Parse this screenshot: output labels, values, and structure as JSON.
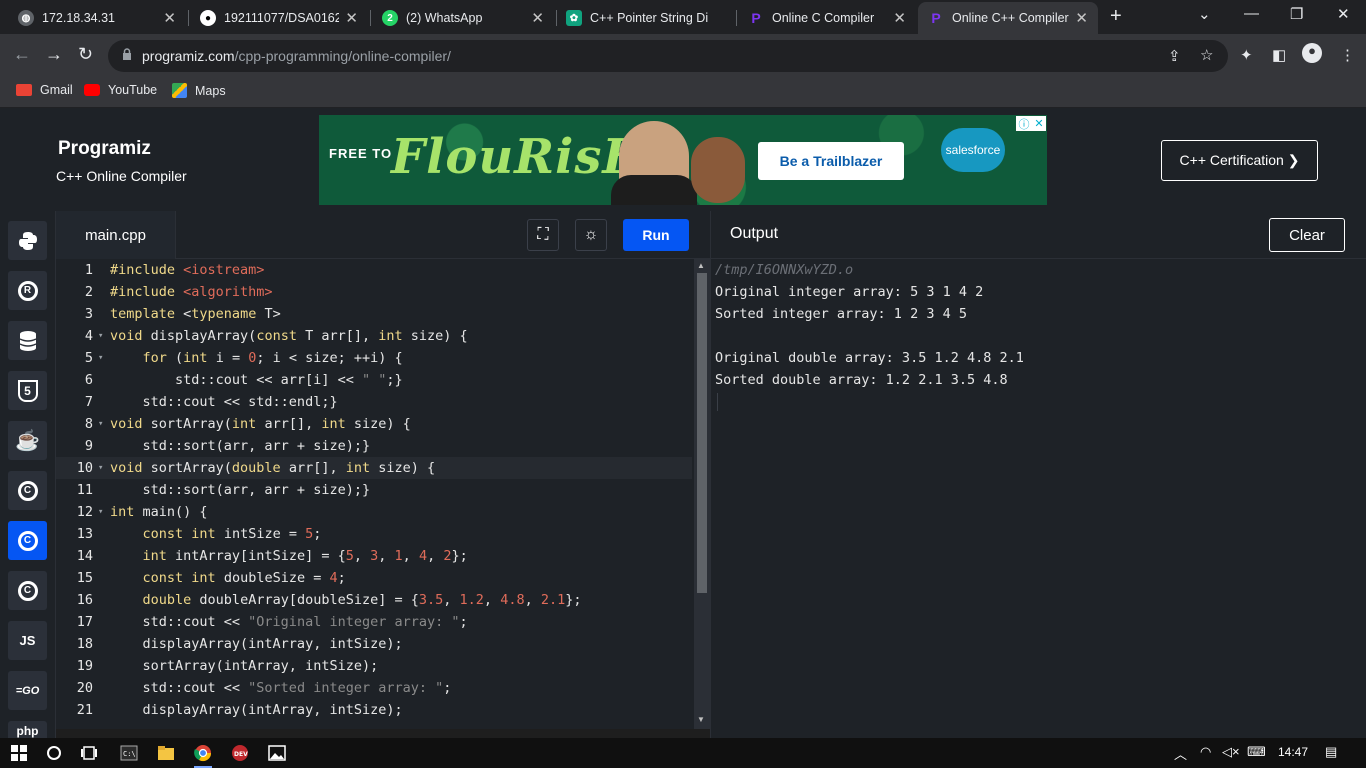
{
  "browser": {
    "tabs": [
      {
        "title": "172.18.34.31",
        "active": false,
        "icon": "globe-icon"
      },
      {
        "title": "192111077/DSA0162",
        "active": false,
        "icon": "github-icon"
      },
      {
        "title": "(2) WhatsApp",
        "active": false,
        "icon": "whatsapp-icon"
      },
      {
        "title": "C++ Pointer String Di",
        "active": false,
        "icon": "chatgpt-icon"
      },
      {
        "title": "Online C Compiler",
        "active": false,
        "icon": "programiz-icon"
      },
      {
        "title": "Online C++ Compiler",
        "active": true,
        "icon": "programiz-icon"
      }
    ],
    "url_domain": "programiz.com",
    "url_path": "/cpp-programming/online-compiler/",
    "bookmarks": [
      {
        "label": "Gmail",
        "icon": "gmail-icon"
      },
      {
        "label": "YouTube",
        "icon": "youtube-icon"
      },
      {
        "label": "Maps",
        "icon": "maps-icon"
      }
    ]
  },
  "site": {
    "logo": "Programiz",
    "subtitle": "C++ Online Compiler",
    "ad": {
      "free_to": "FREE TO",
      "headline": "FlouRisH",
      "cta": "Be a Trailblazer",
      "brand": "salesforce"
    },
    "cert_button": "C++ Certification ❯"
  },
  "editor": {
    "filename": "main.cpp",
    "run_label": "Run",
    "highlighted_line": 10,
    "lines": [
      {
        "n": "1",
        "fold": "",
        "code": "#include <iostream>"
      },
      {
        "n": "2",
        "fold": "",
        "code": "#include <algorithm>"
      },
      {
        "n": "3",
        "fold": "",
        "code": "template <typename T>"
      },
      {
        "n": "4",
        "fold": "▾",
        "code": "void displayArray(const T arr[], int size) {"
      },
      {
        "n": "5",
        "fold": "▾",
        "code": "    for (int i = 0; i < size; ++i) {"
      },
      {
        "n": "6",
        "fold": "",
        "code": "        std::cout << arr[i] << \" \";}"
      },
      {
        "n": "7",
        "fold": "",
        "code": "    std::cout << std::endl;}"
      },
      {
        "n": "8",
        "fold": "▾",
        "code": "void sortArray(int arr[], int size) {"
      },
      {
        "n": "9",
        "fold": "",
        "code": "    std::sort(arr, arr + size);}"
      },
      {
        "n": "10",
        "fold": "▾",
        "code": "void sortArray(double arr[], int size) {"
      },
      {
        "n": "11",
        "fold": "",
        "code": "    std::sort(arr, arr + size);}"
      },
      {
        "n": "12",
        "fold": "▾",
        "code": "int main() {"
      },
      {
        "n": "13",
        "fold": "",
        "code": "    const int intSize = 5;"
      },
      {
        "n": "14",
        "fold": "",
        "code": "    int intArray[intSize] = {5, 3, 1, 4, 2};"
      },
      {
        "n": "15",
        "fold": "",
        "code": "    const int doubleSize = 4;"
      },
      {
        "n": "16",
        "fold": "",
        "code": "    double doubleArray[doubleSize] = {3.5, 1.2, 4.8, 2.1};"
      },
      {
        "n": "17",
        "fold": "",
        "code": "    std::cout << \"Original integer array: \";"
      },
      {
        "n": "18",
        "fold": "",
        "code": "    displayArray(intArray, intSize);"
      },
      {
        "n": "19",
        "fold": "",
        "code": "    sortArray(intArray, intSize);"
      },
      {
        "n": "20",
        "fold": "",
        "code": "    std::cout << \"Sorted integer array: \";"
      },
      {
        "n": "21",
        "fold": "",
        "code": "    displayArray(intArray, intSize);"
      }
    ]
  },
  "output": {
    "title": "Output",
    "clear_label": "Clear",
    "path": "/tmp/I6ONNXwYZD.o",
    "lines": [
      "Original integer array: 5 3 1 4 2",
      "Sorted integer array: 1 2 3 4 5",
      "",
      "Original double array: 3.5 1.2 4.8 2.1",
      "Sorted double array: 1.2 2.1 3.5 4.8"
    ]
  },
  "languages": [
    {
      "name": "python-icon",
      "label": "",
      "active": false
    },
    {
      "name": "r-icon",
      "label": "R",
      "active": false
    },
    {
      "name": "sql-icon",
      "label": "",
      "active": false
    },
    {
      "name": "html-icon",
      "label": "5",
      "active": false
    },
    {
      "name": "java-icon",
      "label": "",
      "active": false
    },
    {
      "name": "c-icon",
      "label": "C",
      "active": false
    },
    {
      "name": "cpp-icon",
      "label": "C",
      "active": true
    },
    {
      "name": "csharp-icon",
      "label": "C",
      "active": false
    },
    {
      "name": "js-icon",
      "label": "JS",
      "active": false
    },
    {
      "name": "go-icon",
      "label": "=GO",
      "active": false
    },
    {
      "name": "php-icon",
      "label": "php",
      "active": false
    }
  ],
  "taskbar": {
    "time": "14:47"
  },
  "colors": {
    "accent": "#0556f3",
    "editor_bg": "#1e2227",
    "keyword": "#f0d98a",
    "string_number": "#e06c5a"
  }
}
